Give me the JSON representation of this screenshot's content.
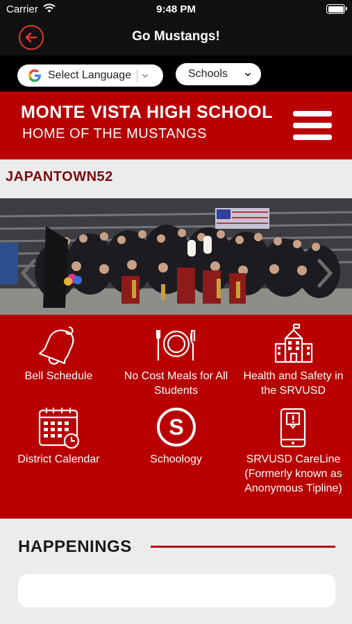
{
  "status_bar": {
    "carrier": "Carrier",
    "time": "9:48 PM"
  },
  "nav": {
    "title": "Go Mustangs!"
  },
  "language_select": {
    "label": "Select Language"
  },
  "schools_select": {
    "label": "Schools"
  },
  "school": {
    "name": "MONTE VISTA HIGH SCHOOL",
    "tagline": "HOME OF THE MUSTANGS"
  },
  "slide": {
    "caption": "JAPANTOWN52"
  },
  "quick_links": [
    {
      "label": "Bell Schedule",
      "icon": "bell-icon"
    },
    {
      "label": "No Cost Meals for All Students",
      "icon": "plate-utensils-icon"
    },
    {
      "label": "Health and Safety in the SRVUSD",
      "icon": "school-building-icon"
    },
    {
      "label": "District Calendar",
      "icon": "calendar-clock-icon"
    },
    {
      "label": "Schoology",
      "icon": "schoology-s-icon"
    },
    {
      "label": "SRVUSD CareLine (Formerly known as Anonymous Tipline)",
      "icon": "phone-alert-icon"
    }
  ],
  "happenings": {
    "title": "HAPPENINGS"
  },
  "colors": {
    "brand_red": "#b80000",
    "accent_red": "#e03b2e",
    "dark": "#111111",
    "caption_red": "#7a0c0c"
  }
}
